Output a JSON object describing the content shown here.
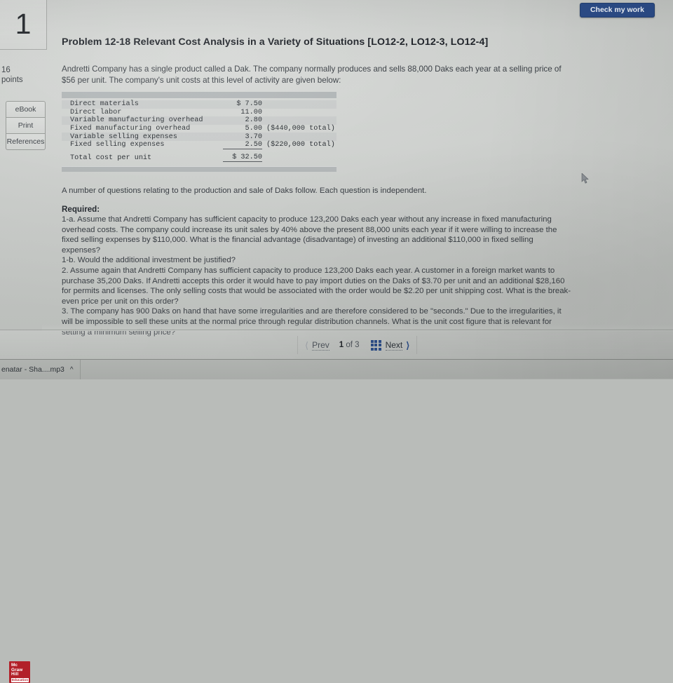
{
  "question": {
    "number": "1",
    "points_value": "16",
    "points_label": "points"
  },
  "rail": {
    "ebook": "eBook",
    "print": "Print",
    "references": "References"
  },
  "header": {
    "check_button": "Check my work",
    "title": "Problem 12-18 Relevant Cost Analysis in a Variety of Situations [LO12-2, LO12-3, LO12-4]"
  },
  "body": {
    "intro": "Andretti Company has a single product called a Dak. The company normally produces and sells 88,000 Daks each year at a selling price of $56 per unit. The company's unit costs at this level of activity are given below:",
    "after_table": "A number of questions relating to the production and sale of Daks follow. Each question is independent.",
    "required_label": "Required:",
    "questions": [
      "1-a. Assume that Andretti Company has sufficient capacity to produce 123,200 Daks each year without any increase in fixed manufacturing overhead costs. The company could increase its unit sales by 40% above the present 88,000 units each year if it were willing to increase the fixed selling expenses by $110,000. What is the financial advantage (disadvantage) of investing an additional $110,000 in fixed selling expenses?",
      "1-b. Would the additional investment be justified?",
      "2. Assume again that Andretti Company has sufficient capacity to produce 123,200 Daks each year. A customer in a foreign market wants to purchase 35,200 Daks. If Andretti accepts this order it would have to pay import duties on the Daks of $3.70 per unit and an additional $28,160 for permits and licenses. The only selling costs that would be associated with the order would be $2.20 per unit shipping cost. What is the break-even price per unit on this order?",
      "3. The company has 900 Daks on hand that have some irregularities and are therefore considered to be \"seconds.\" Due to the irregularities, it will be impossible to sell these units at the normal price through regular distribution channels. What is the unit cost figure that is relevant for setting a minimum selling price?"
    ]
  },
  "cost_table": {
    "rows": [
      {
        "name": "Direct materials",
        "amount": "$  7.50",
        "note": ""
      },
      {
        "name": "Direct labor",
        "amount": "11.00",
        "note": ""
      },
      {
        "name": "Variable manufacturing overhead",
        "amount": "2.80",
        "note": ""
      },
      {
        "name": "Fixed manufacturing overhead",
        "amount": "5.00",
        "note": "($440,000 total)"
      },
      {
        "name": "Variable selling expenses",
        "amount": "3.70",
        "note": ""
      },
      {
        "name": "Fixed selling expenses",
        "amount": "2.50",
        "note": "($220,000 total)"
      }
    ],
    "total": {
      "name": "Total cost per unit",
      "amount": "$ 32.50",
      "note": ""
    }
  },
  "footer": {
    "prev_label": "Prev",
    "next_label": "Next",
    "pager_current": "1",
    "pager_of": "of",
    "pager_total": "3",
    "grid_icon": "grid-icon",
    "prev_icon": "chevron-left-icon",
    "next_icon": "chevron-right-icon"
  },
  "brand": {
    "line1": "Mc",
    "line2": "Graw",
    "line3": "Hill",
    "line4": "Education"
  },
  "taskbar": {
    "download_item": "enatar - Sha....mp3",
    "caret": "^"
  },
  "colors": {
    "accent_blue": "#2d4d86",
    "brand_red": "#b22029",
    "page_bg": "#c4c7c4"
  }
}
